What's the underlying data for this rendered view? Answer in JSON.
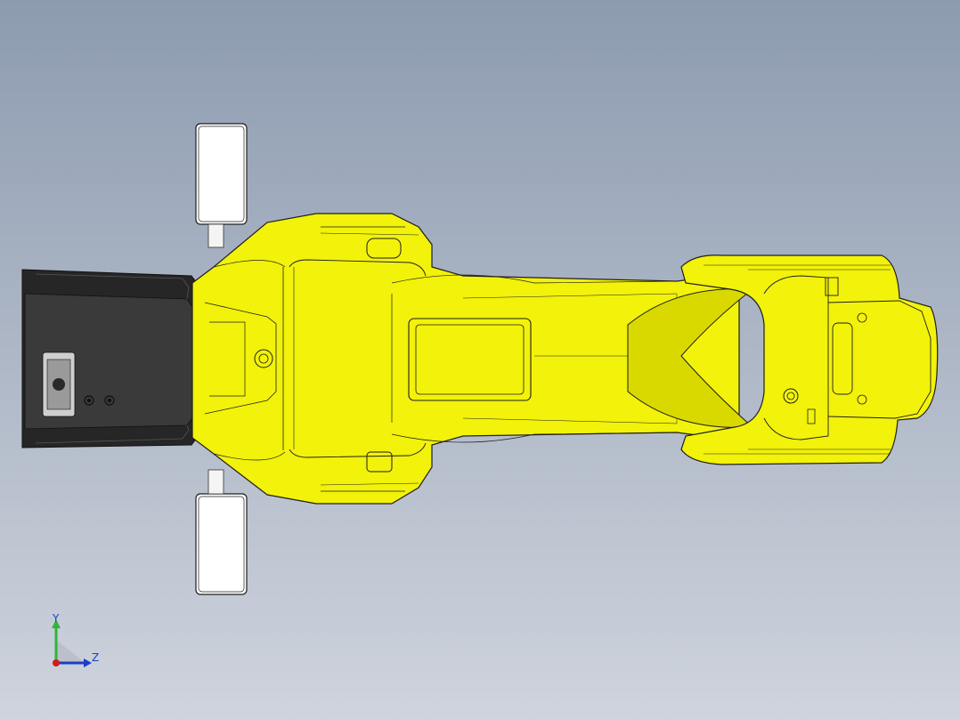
{
  "viewport": {
    "background_top": "#8d9bb0",
    "background_bottom": "#cfd4dd"
  },
  "model": {
    "body_color": "#f2f20a",
    "body_shadow": "#d9d900",
    "edge_color": "#1f1f1f",
    "motor_color": "#3a3a3a",
    "motor_dark": "#262626",
    "plate_color": "#ffffff"
  },
  "triad": {
    "y_label": "Y",
    "z_label": "Z",
    "y_color": "#2fb53a",
    "z_color": "#1a3fc4",
    "origin_color": "#d41c1c"
  }
}
